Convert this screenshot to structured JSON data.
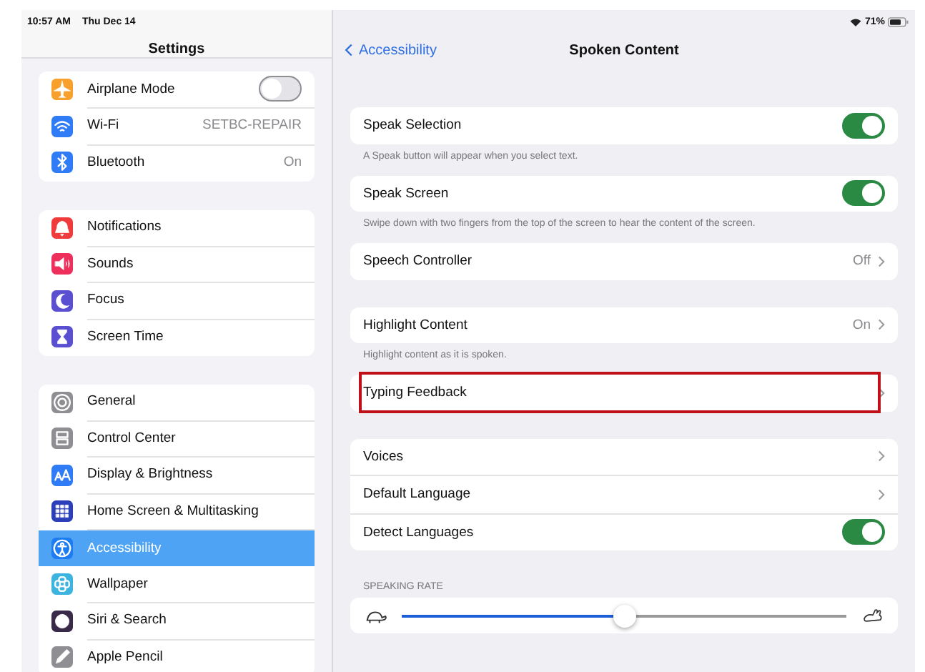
{
  "status_bar": {
    "time": "10:57 AM",
    "date": "Thu Dec 14",
    "battery": "71%"
  },
  "sidebar": {
    "title": "Settings",
    "groups": [
      [
        {
          "label": "Airplane Mode",
          "kind": "toggle",
          "on": false,
          "selected": false,
          "color": "#f7a02c"
        },
        {
          "label": "Wi-Fi",
          "kind": "value",
          "value": "SETBC-REPAIR",
          "selected": false,
          "color": "#2f7cf6"
        },
        {
          "label": "Bluetooth",
          "kind": "value",
          "value": "On",
          "selected": false,
          "color": "#2f7cf6"
        }
      ],
      [
        {
          "label": "Notifications",
          "kind": "plain",
          "selected": false,
          "color": "#ef3b3b"
        },
        {
          "label": "Sounds",
          "kind": "plain",
          "selected": false,
          "color": "#ee2f5b"
        },
        {
          "label": "Focus",
          "kind": "plain",
          "selected": false,
          "color": "#5a4fd1"
        },
        {
          "label": "Screen Time",
          "kind": "plain",
          "selected": false,
          "color": "#5a4fd1"
        }
      ],
      [
        {
          "label": "General",
          "kind": "plain",
          "selected": false,
          "color": "#8e8e93"
        },
        {
          "label": "Control Center",
          "kind": "plain",
          "selected": false,
          "color": "#8e8e93"
        },
        {
          "label": "Display & Brightness",
          "kind": "plain",
          "selected": false,
          "color": "#2f7cf6"
        },
        {
          "label": "Home Screen & Multitasking",
          "kind": "plain",
          "selected": false,
          "color": "#2b3fb8"
        },
        {
          "label": "Accessibility",
          "kind": "plain",
          "selected": true,
          "color": "#1e7cf2"
        },
        {
          "label": "Wallpaper",
          "kind": "plain",
          "selected": false,
          "color": "#3db3e0"
        },
        {
          "label": "Siri & Search",
          "kind": "plain",
          "selected": false,
          "color": "#3a2a4a"
        },
        {
          "label": "Apple Pencil",
          "kind": "plain",
          "selected": false,
          "color": "#8e8e93"
        }
      ]
    ]
  },
  "detail": {
    "back": "Accessibility",
    "title": "Spoken Content",
    "sections": [
      {
        "rows": [
          {
            "label": "Speak Selection",
            "kind": "toggle",
            "on": true
          }
        ],
        "footer": "A Speak button will appear when you select text."
      },
      {
        "rows": [
          {
            "label": "Speak Screen",
            "kind": "toggle",
            "on": true
          }
        ],
        "footer": "Swipe down with two fingers from the top of the screen to hear the content of the screen."
      },
      {
        "rows": [
          {
            "label": "Speech Controller",
            "kind": "chevron",
            "value": "Off"
          }
        ]
      },
      {
        "rows": [
          {
            "label": "Highlight Content",
            "kind": "chevron",
            "value": "On"
          }
        ],
        "footer": "Highlight content as it is spoken."
      },
      {
        "rows": [
          {
            "label": "Typing Feedback",
            "kind": "chevron",
            "annotated": true
          }
        ]
      },
      {
        "rows": [
          {
            "label": "Voices",
            "kind": "chevron"
          },
          {
            "label": "Default Language",
            "kind": "chevron"
          },
          {
            "label": "Detect Languages",
            "kind": "toggle",
            "on": true
          }
        ]
      }
    ],
    "speaking_rate": {
      "header": "SPEAKING RATE",
      "level": 0.5
    }
  }
}
